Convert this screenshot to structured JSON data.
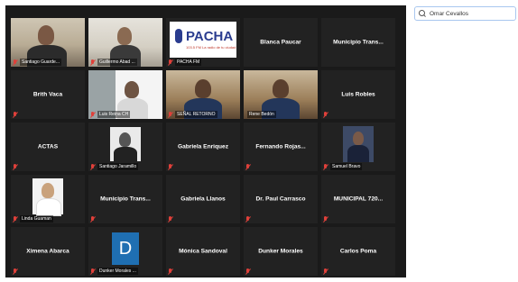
{
  "search": {
    "value": "Omar Cevallos"
  },
  "tiles": [
    {
      "label": "Santiago Guarde..."
    },
    {
      "label": "Guillermo Abad ..."
    },
    {
      "label": "PACHA FM",
      "logo_text": "PACHA",
      "logo_sub": "103.5 FM La radio de tu ciudad"
    },
    {
      "name": "Blanca Paucar"
    },
    {
      "name": "Municipio  Trans..."
    },
    {
      "name": "Brith Vaca"
    },
    {
      "label": "Luis Reina CH"
    },
    {
      "label": "SEÑAL RETORNO"
    },
    {
      "label": "Rene Bedón"
    },
    {
      "name": "Luis Robles"
    },
    {
      "name": "ACTAS"
    },
    {
      "label": "Santiago Jaramillo"
    },
    {
      "name": "Gabriela Enriquez"
    },
    {
      "name": "Fernando  Rojas..."
    },
    {
      "label": "Samuel Bravo"
    },
    {
      "label": "Linda Guaman"
    },
    {
      "name": "Municipio  Trans..."
    },
    {
      "name": "Gabriela Llanos"
    },
    {
      "name": "Dr. Paul Carrasco"
    },
    {
      "name": "MUNICIPAL  720..."
    },
    {
      "name": "Ximena Abarca"
    },
    {
      "label": "Dunker Morales ...",
      "avatar_letter": "D"
    },
    {
      "name": "Mónica Sandoval"
    },
    {
      "name": "Dunker Morales"
    },
    {
      "name": "Carlos Poma"
    }
  ],
  "colors": {
    "active_speaker_border": "#7ec84a",
    "muted_icon": "#e0403a",
    "tile_bg": "#222222"
  }
}
